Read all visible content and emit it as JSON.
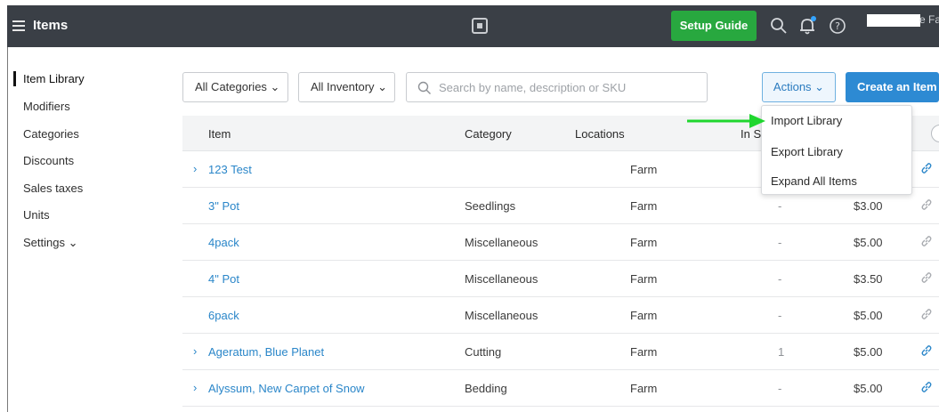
{
  "topbar": {
    "title": "Items",
    "setup_label": "Setup Guide",
    "account_text": "e Far",
    "icons": [
      "menu-icon",
      "square-logo-icon",
      "search-icon",
      "bell-icon",
      "help-icon"
    ]
  },
  "sidebar": {
    "items": [
      {
        "label": "Item Library",
        "active": true
      },
      {
        "label": "Modifiers"
      },
      {
        "label": "Categories"
      },
      {
        "label": "Discounts"
      },
      {
        "label": "Sales taxes"
      },
      {
        "label": "Units"
      },
      {
        "label": "Settings ⌄"
      }
    ]
  },
  "filters": {
    "categories_label": "All Categories ⌄",
    "inventory_label": "All Inventory ⌄",
    "search_placeholder": "Search by name, description or SKU"
  },
  "actions": {
    "label": "Actions ⌄",
    "create_label": "Create an Item",
    "menu": [
      "Import Library",
      "Export Library",
      "Expand All Items"
    ]
  },
  "table": {
    "headers": [
      "Item",
      "Category",
      "Locations",
      "In S"
    ],
    "rows": [
      {
        "expand": true,
        "name": "123 Test",
        "category": "",
        "location": "Farm",
        "stock": "",
        "price": "",
        "link": "blue"
      },
      {
        "expand": false,
        "name": "3\" Pot",
        "category": "Seedlings",
        "location": "Farm",
        "stock": "-",
        "price": "$3.00",
        "link": "gray"
      },
      {
        "expand": false,
        "name": "4pack",
        "category": "Miscellaneous",
        "location": "Farm",
        "stock": "-",
        "price": "$5.00",
        "link": "gray"
      },
      {
        "expand": false,
        "name": "4\" Pot",
        "category": "Miscellaneous",
        "location": "Farm",
        "stock": "-",
        "price": "$3.50",
        "link": "gray"
      },
      {
        "expand": false,
        "name": "6pack",
        "category": "Miscellaneous",
        "location": "Farm",
        "stock": "-",
        "price": "$5.00",
        "link": "gray"
      },
      {
        "expand": true,
        "name": "Ageratum, Blue Planet",
        "category": "Cutting",
        "location": "Farm",
        "stock": "1",
        "price": "$5.00",
        "link": "blue"
      },
      {
        "expand": true,
        "name": "Alyssum, New Carpet of Snow",
        "category": "Bedding",
        "location": "Farm",
        "stock": "-",
        "price": "$5.00",
        "link": "blue"
      }
    ]
  },
  "colors": {
    "topbar": "#3a3f46",
    "setup": "#28a83f",
    "primary": "#2d8ad3",
    "link": "#2a86c9",
    "arrow": "#1fd62e"
  }
}
